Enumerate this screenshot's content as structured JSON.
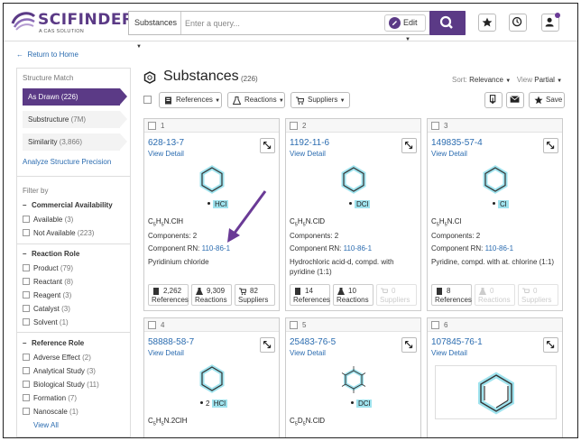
{
  "header": {
    "logo_text": "SCIFINDER",
    "logo_sup": "n",
    "logo_sub": "A CAS SOLUTION",
    "search_type": "Substances",
    "search_placeholder": "Enter a query...",
    "edit_label": "Edit"
  },
  "return_link": "Return to Home",
  "sidebar": {
    "structure_match_title": "Structure Match",
    "match_items": [
      {
        "label": "As Drawn (226)"
      },
      {
        "label": "Substructure",
        "count": "(7M)"
      },
      {
        "label": "Similarity",
        "count": "(3,866)"
      }
    ],
    "analyze_link": "Analyze Structure Precision",
    "filter_by": "Filter by",
    "commercial": {
      "title": "Commercial Availability",
      "options": [
        {
          "label": "Available",
          "count": "(3)"
        },
        {
          "label": "Not Available",
          "count": "(223)"
        }
      ]
    },
    "reaction_role": {
      "title": "Reaction Role",
      "options": [
        {
          "label": "Product",
          "count": "(79)"
        },
        {
          "label": "Reactant",
          "count": "(8)"
        },
        {
          "label": "Reagent",
          "count": "(3)"
        },
        {
          "label": "Catalyst",
          "count": "(3)"
        },
        {
          "label": "Solvent",
          "count": "(1)"
        }
      ]
    },
    "reference_role": {
      "title": "Reference Role",
      "options": [
        {
          "label": "Adverse Effect",
          "count": "(2)"
        },
        {
          "label": "Analytical Study",
          "count": "(3)"
        },
        {
          "label": "Biological Study",
          "count": "(11)"
        },
        {
          "label": "Formation",
          "count": "(7)"
        },
        {
          "label": "Nanoscale",
          "count": "(1)"
        }
      ]
    },
    "view_all": "View All"
  },
  "main": {
    "title": "Substances",
    "count": "(226)",
    "sort_label": "Sort:",
    "sort_value": "Relevance",
    "view_label": "View",
    "view_value": "Partial",
    "toolbar": {
      "references": "References",
      "reactions": "Reactions",
      "suppliers": "Suppliers",
      "save": "Save"
    }
  },
  "cards": [
    {
      "num": "1",
      "rn": "628-13-7",
      "view": "View Detail",
      "salt": "HCl",
      "formula": "C5H5N.ClH",
      "components": "Components: 2",
      "comp_rn_label": "Component RN: ",
      "comp_rn": "110-86-1",
      "name": "Pyridinium chloride",
      "refs": "2,262",
      "refs_label": "References",
      "rxns": "9,309",
      "rxns_label": "Reactions",
      "sups": "82",
      "sups_label": "Suppliers"
    },
    {
      "num": "2",
      "rn": "1192-11-6",
      "view": "View Detail",
      "salt": "DCl",
      "formula": "C5H5N.ClD",
      "components": "Components: 2",
      "comp_rn_label": "Component RN: ",
      "comp_rn": "110-86-1",
      "name": "Hydrochloric acid-d, compd. with pyridine (1:1)",
      "refs": "14",
      "refs_label": "References",
      "rxns": "10",
      "rxns_label": "Reactions",
      "sups": "0",
      "sups_label": "Suppliers"
    },
    {
      "num": "3",
      "rn": "149835-57-4",
      "view": "View Detail",
      "salt": "Cl",
      "formula": "C5H5N.Cl",
      "components": "Components: 2",
      "comp_rn_label": "Component RN: ",
      "comp_rn": "110-86-1",
      "name": "Pyridine, compd. with at. chlorine (1:1)",
      "refs": "8",
      "refs_label": "References",
      "rxns": "0",
      "rxns_label": "Reactions",
      "sups": "0",
      "sups_label": "Suppliers"
    },
    {
      "num": "4",
      "rn": "58888-58-7",
      "view": "View Detail",
      "salt_prefix": "2",
      "salt": "HCl",
      "formula": "C5H5N.2ClH"
    },
    {
      "num": "5",
      "rn": "25483-76-5",
      "view": "View Detail",
      "salt": "DCl",
      "formula": "C5D5N.ClD"
    },
    {
      "num": "6",
      "rn": "107845-76-1",
      "view": "View Detail"
    }
  ],
  "colors": {
    "brand_purple": "#5b3a86",
    "link_blue": "#2b6cb0",
    "highlight_cyan": "#9fe3ee",
    "annotation": "#6a3a96"
  }
}
